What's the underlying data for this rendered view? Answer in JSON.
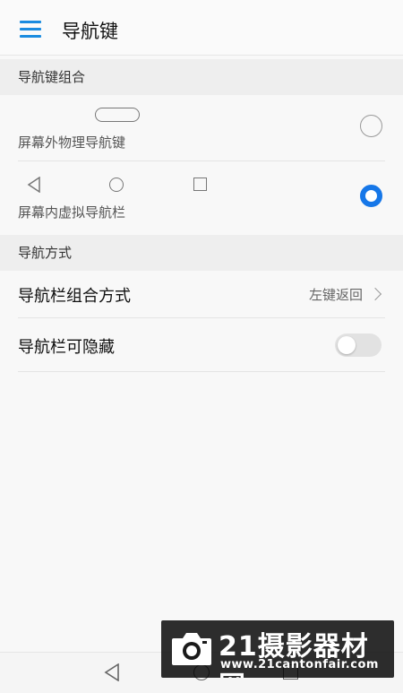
{
  "app_bar": {
    "title": "导航键",
    "menu_icon": "hamburger-menu-icon",
    "accent": "#1a8be0"
  },
  "section_combination": {
    "header": "导航键组合",
    "options": [
      {
        "label": "屏幕外物理导航键",
        "icon": "pill-home-key-icon",
        "selected": false
      },
      {
        "label": "屏幕内虚拟导航栏",
        "icons": [
          "back-triangle-icon",
          "home-circle-icon",
          "recents-square-icon"
        ],
        "selected": true
      }
    ]
  },
  "section_mode": {
    "header": "导航方式",
    "items": [
      {
        "label": "导航栏组合方式",
        "value": "左键返回"
      },
      {
        "label": "导航栏可隐藏",
        "toggle_on": false
      }
    ]
  },
  "watermark": {
    "title": "21摄影器材网",
    "url": "www.21cantonfair.com"
  },
  "colors": {
    "selected_radio": "#1677e8",
    "background": "#f8f8f8"
  }
}
